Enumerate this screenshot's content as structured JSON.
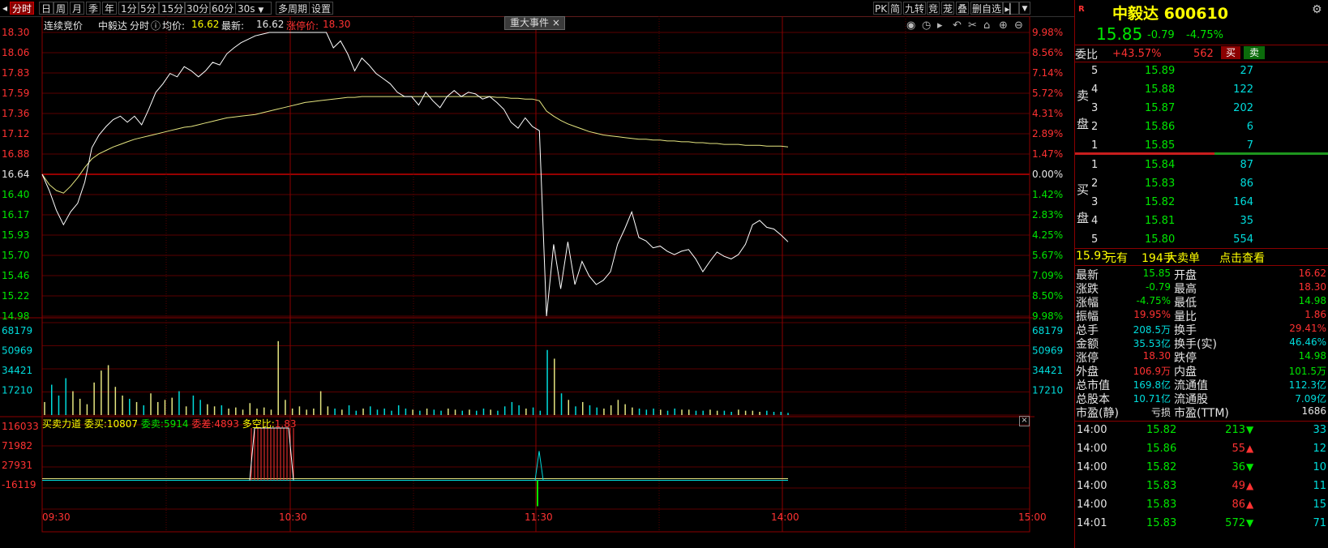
{
  "toolbar": {
    "tabs": [
      "分时",
      "日",
      "周",
      "月",
      "季",
      "年",
      "1分",
      "5分",
      "15分",
      "30分",
      "60分",
      "30s"
    ],
    "multi_period": "多周期",
    "settings": "设置",
    "right_buttons": [
      "PK",
      "简",
      "九转",
      "竞",
      "茏",
      "叠",
      "删自选"
    ]
  },
  "chart_header": {
    "auction": "连续竞价",
    "name": "中毅达",
    "mode": "分时",
    "avg_label": "均价:",
    "avg_value": "16.62",
    "latest_label": "最新:",
    "latest_value": "16.62",
    "limit_label": "涨停价:",
    "limit_value": "18.30",
    "event_button": "重大事件",
    "close_x": "×"
  },
  "chart_data": {
    "type": "line",
    "title": "中毅达 分时",
    "prev_close": 16.64,
    "price_ticks": [
      "18.30",
      "18.06",
      "17.83",
      "17.59",
      "17.36",
      "17.12",
      "16.88",
      "16.64",
      "16.40",
      "16.17",
      "15.93",
      "15.70",
      "15.46",
      "15.22",
      "14.98"
    ],
    "pct_ticks": [
      "9.98%",
      "8.56%",
      "7.14%",
      "5.72%",
      "4.31%",
      "2.89%",
      "1.47%",
      "0.00%",
      "1.42%",
      "2.83%",
      "4.25%",
      "5.67%",
      "7.09%",
      "8.50%",
      "9.98%"
    ],
    "volume_ticks": [
      "68179",
      "50969",
      "34421",
      "17210"
    ],
    "force_ticks": [
      "116033",
      "71982",
      "27931",
      "-16119"
    ],
    "time_labels": [
      "09:30",
      "10:30",
      "11:30",
      "14:00",
      "15:00"
    ],
    "price_series": [
      16.64,
      16.45,
      16.22,
      16.05,
      16.2,
      16.3,
      16.55,
      16.95,
      17.1,
      17.2,
      17.28,
      17.32,
      17.25,
      17.32,
      17.22,
      17.4,
      17.6,
      17.7,
      17.82,
      17.78,
      17.9,
      17.85,
      17.78,
      17.85,
      17.95,
      17.92,
      18.05,
      18.12,
      18.18,
      18.22,
      18.26,
      18.28,
      18.3,
      18.3,
      18.3,
      18.3,
      18.3,
      18.3,
      18.3,
      18.3,
      18.3,
      18.12,
      18.2,
      18.05,
      17.85,
      18.0,
      17.92,
      17.82,
      17.76,
      17.7,
      17.6,
      17.55,
      17.55,
      17.45,
      17.6,
      17.5,
      17.42,
      17.55,
      17.62,
      17.55,
      17.6,
      17.58,
      17.52,
      17.55,
      17.48,
      17.4,
      17.25,
      17.18,
      17.3,
      17.2,
      17.15,
      14.98,
      15.82,
      15.3,
      15.85,
      15.35,
      15.62,
      15.45,
      15.35,
      15.4,
      15.5,
      15.82,
      16.0,
      16.2,
      15.9,
      15.86,
      15.78,
      15.8,
      15.74,
      15.7,
      15.74,
      15.76,
      15.65,
      15.5,
      15.62,
      15.73,
      15.68,
      15.65,
      15.7,
      15.82,
      16.05,
      16.1,
      16.02,
      16.0,
      15.93,
      15.85
    ],
    "avg_series": [
      16.64,
      16.52,
      16.45,
      16.42,
      16.5,
      16.6,
      16.72,
      16.82,
      16.88,
      16.92,
      16.96,
      16.99,
      17.02,
      17.05,
      17.07,
      17.09,
      17.11,
      17.13,
      17.15,
      17.17,
      17.19,
      17.2,
      17.22,
      17.24,
      17.26,
      17.28,
      17.3,
      17.31,
      17.32,
      17.33,
      17.34,
      17.36,
      17.38,
      17.4,
      17.42,
      17.44,
      17.46,
      17.48,
      17.49,
      17.5,
      17.51,
      17.52,
      17.53,
      17.54,
      17.54,
      17.55,
      17.55,
      17.55,
      17.55,
      17.55,
      17.55,
      17.55,
      17.55,
      17.55,
      17.55,
      17.55,
      17.55,
      17.55,
      17.55,
      17.55,
      17.55,
      17.55,
      17.55,
      17.55,
      17.54,
      17.54,
      17.53,
      17.53,
      17.52,
      17.52,
      17.5,
      17.38,
      17.32,
      17.27,
      17.23,
      17.2,
      17.17,
      17.14,
      17.12,
      17.1,
      17.09,
      17.08,
      17.07,
      17.06,
      17.05,
      17.05,
      17.04,
      17.04,
      17.03,
      17.03,
      17.02,
      17.02,
      17.01,
      17.01,
      17.0,
      17.0,
      16.99,
      16.99,
      16.99,
      16.98,
      16.98,
      16.98,
      16.97,
      16.97,
      16.97,
      16.96
    ],
    "volume_series": [
      12000,
      28000,
      18000,
      34000,
      22000,
      15000,
      10000,
      30000,
      41000,
      46000,
      26000,
      18000,
      15000,
      12000,
      9000,
      20000,
      12000,
      14000,
      16000,
      22000,
      8000,
      18000,
      14000,
      10000,
      8000,
      9000,
      6000,
      7000,
      5000,
      11000,
      6000,
      7000,
      5000,
      68179,
      14000,
      6000,
      8000,
      5000,
      6000,
      22000,
      8000,
      6000,
      5000,
      9000,
      4000,
      6000,
      8000,
      5000,
      6000,
      4000,
      9000,
      6000,
      5000,
      4000,
      6000,
      5000,
      4000,
      6000,
      5000,
      4000,
      5000,
      4000,
      6000,
      5000,
      4000,
      8000,
      12000,
      9000,
      6000,
      7000,
      4000,
      60000,
      52000,
      20000,
      14000,
      8000,
      12000,
      9000,
      7000,
      6000,
      9000,
      14000,
      10000,
      7000,
      6000,
      5000,
      6000,
      5000,
      4000,
      6000,
      5000,
      5000,
      4000,
      4000,
      5000,
      4000,
      4000,
      3000,
      5000,
      4000,
      4000,
      3000,
      4000,
      3000,
      3000,
      2000
    ],
    "force_header": {
      "label": "买卖力道",
      "buy_label": "委买:",
      "buy_value": "10807",
      "sell_label": "委卖:",
      "sell_value": "5914",
      "diff_label": "委差:",
      "diff_value": "4893",
      "ratio_label": "多空比:",
      "ratio_value": "1.83"
    }
  },
  "quote": {
    "r_badge": "R",
    "name_code": "中毅达 600610",
    "price": "15.85",
    "change": "-0.79",
    "change_pct": "-4.75%",
    "wei_bi_label": "委比",
    "wei_bi_value": "+43.57%",
    "wei_cha_value": "562",
    "buy_btn": "买",
    "sell_btn": "卖",
    "sell_side_label": [
      "卖",
      "盘"
    ],
    "buy_side_label": [
      "买",
      "盘"
    ],
    "asks": [
      {
        "lvl": "5",
        "price": "15.89",
        "vol": "27"
      },
      {
        "lvl": "4",
        "price": "15.88",
        "vol": "122"
      },
      {
        "lvl": "3",
        "price": "15.87",
        "vol": "202"
      },
      {
        "lvl": "2",
        "price": "15.86",
        "vol": "6"
      },
      {
        "lvl": "1",
        "price": "15.85",
        "vol": "7"
      }
    ],
    "bids": [
      {
        "lvl": "1",
        "price": "15.84",
        "vol": "87"
      },
      {
        "lvl": "2",
        "price": "15.83",
        "vol": "86"
      },
      {
        "lvl": "3",
        "price": "15.82",
        "vol": "164"
      },
      {
        "lvl": "4",
        "price": "15.81",
        "vol": "35"
      },
      {
        "lvl": "5",
        "price": "15.80",
        "vol": "554"
      }
    ],
    "big_order": {
      "price": "15.93",
      "you": "元有",
      "qty": "194手",
      "text": "大卖单",
      "link": "点击查看"
    },
    "stats": [
      {
        "l1": "最新",
        "v1": "15.85",
        "l2": "开盘",
        "v2": "16.62"
      },
      {
        "l1": "涨跌",
        "v1": "-0.79",
        "l2": "最高",
        "v2": "18.30"
      },
      {
        "l1": "涨幅",
        "v1": "-4.75%",
        "l2": "最低",
        "v2": "14.98"
      },
      {
        "l1": "振幅",
        "v1": "19.95%",
        "l2": "量比",
        "v2": "1.86"
      },
      {
        "l1": "总手",
        "v1": "208.5万",
        "l2": "换手",
        "v2": "29.41%"
      },
      {
        "l1": "金额",
        "v1": "35.53亿",
        "l2": "换手(实)",
        "v2": "46.46%"
      },
      {
        "l1": "涨停",
        "v1": "18.30",
        "l2": "跌停",
        "v2": "14.98"
      },
      {
        "l1": "外盘",
        "v1": "106.9万",
        "l2": "内盘",
        "v2": "101.5万"
      },
      {
        "l1": "总市值",
        "v1": "169.8亿",
        "l2": "流通值",
        "v2": "112.3亿"
      },
      {
        "l1": "总股本",
        "v1": "10.71亿",
        "l2": "流通股",
        "v2": "7.09亿"
      },
      {
        "l1": "市盈(静)",
        "v1": "亏损",
        "l2": "市盈(TTM)",
        "v2": "1686"
      }
    ],
    "ticks": [
      {
        "t": "14:00",
        "p": "15.82",
        "v": "213",
        "dir": "down",
        "n": "33"
      },
      {
        "t": "14:00",
        "p": "15.86",
        "v": "55",
        "dir": "up",
        "n": "12"
      },
      {
        "t": "14:00",
        "p": "15.82",
        "v": "36",
        "dir": "down",
        "n": "10"
      },
      {
        "t": "14:00",
        "p": "15.83",
        "v": "49",
        "dir": "up",
        "n": "11"
      },
      {
        "t": "14:00",
        "p": "15.83",
        "v": "86",
        "dir": "up",
        "n": "15"
      },
      {
        "t": "14:01",
        "p": "15.83",
        "v": "572",
        "dir": "down",
        "n": "71"
      }
    ],
    "colors": {
      "up": "#ff3232",
      "down": "#00e600",
      "accent": "#00dcdc"
    }
  }
}
